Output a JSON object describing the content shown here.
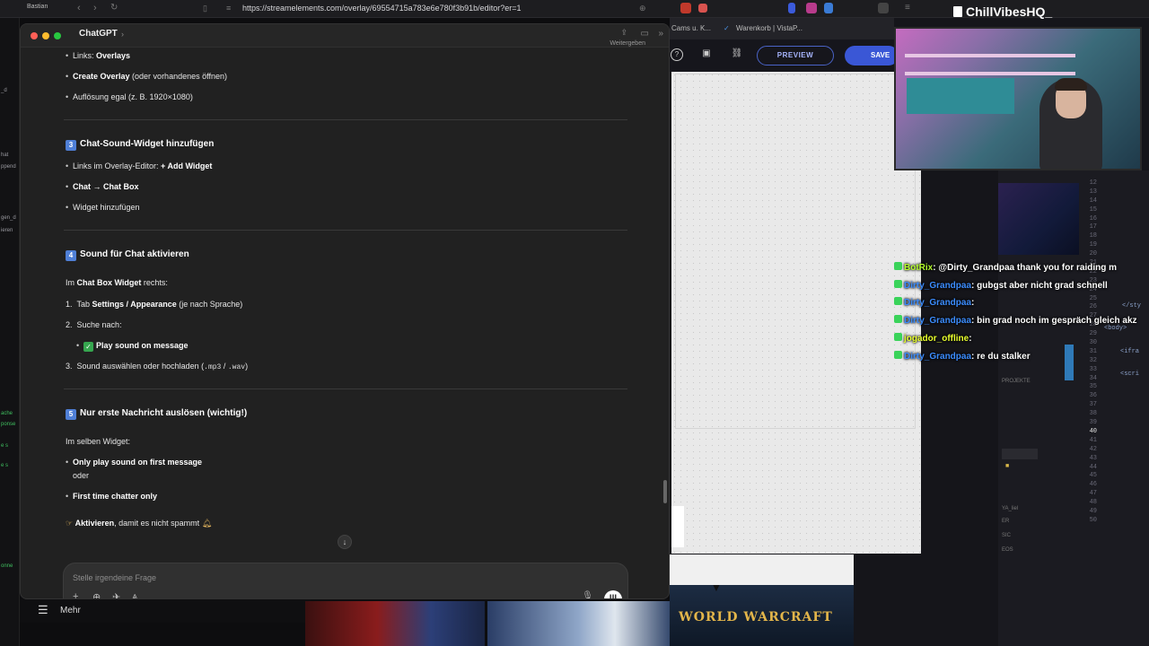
{
  "browser": {
    "tab_label": "Bastian",
    "url": "https://streamelements.com/overlay/69554715a783e6e780f3b91b/editor?er=1"
  },
  "left_strip": {
    "fragments": [
      "errysp",
      "_d",
      "hat",
      "ppend",
      "gen_d",
      "ieren",
      "ache",
      "ponse",
      "e s",
      "e s",
      "onne"
    ]
  },
  "chatgpt": {
    "window_title": "ChatGPT",
    "share_label": "Weitergeben",
    "section_links": {
      "line1_prefix": "Links: ",
      "line1_bold": "Overlays",
      "line2_bold": "Create Overlay",
      "line2_rest": " (oder vorhandenes öffnen)",
      "line3": "Auflösung egal (z. B. 1920×1080)"
    },
    "section3": {
      "badge": "3",
      "title": "Chat-Sound-Widget hinzufügen",
      "b1_prefix": "Links im Overlay-Editor: ",
      "b1_bold": "+ Add Widget",
      "b2_bold": "Chat → Chat Box",
      "b3": "Widget hinzufügen"
    },
    "section4": {
      "badge": "4",
      "title": "Sound für Chat aktivieren",
      "intro_prefix": "Im ",
      "intro_bold": "Chat Box Widget",
      "intro_rest": " rechts:",
      "step1_num": "1.",
      "step1_prefix": "Tab ",
      "step1_bold": "Settings / Appearance",
      "step1_rest": " (je nach Sprache)",
      "step2_num": "2.",
      "step2": "Suche nach:",
      "step2_sub_bold": "Play sound on message",
      "step3_num": "3.",
      "step3_prefix": "Sound auswählen oder hochladen (",
      "step3_code1": ".mp3",
      "step3_sep": " / ",
      "step3_code2": ".wav",
      "step3_rest": ")"
    },
    "section5": {
      "badge": "5",
      "title": "Nur erste Nachricht auslösen (wichtig!)",
      "intro": "Im selben Widget:",
      "b1_bold": "Only play sound on first message",
      "b1_sub": "oder",
      "b2_bold": "First time chatter only",
      "tip_bold": "Aktivieren",
      "tip_rest": ", damit es nicht spammt"
    },
    "composer_placeholder": "Stelle irgendeine Frage",
    "bottom_more": "Mehr"
  },
  "streamelements": {
    "tabs": [
      "Cams u. K...",
      "Warenkorb | VistaP..."
    ],
    "preview_label": "PREVIEW",
    "save_label": "SAVE"
  },
  "stream": {
    "channel": "ChillVibesHQ_",
    "game_logo": "WORLD WARCRAFT"
  },
  "chat_messages": [
    {
      "user": "BotRix",
      "text": ": @Dirty_Grandpaa thank you for raiding m",
      "color": "#b5ff2e"
    },
    {
      "user": "Dirty_Grandpaa",
      "text": ": gubgst aber nicht grad schnell",
      "color": "#3c8dff"
    },
    {
      "user": "Dirty_Grandpaa",
      "text": ":",
      "color": "#3c8dff"
    },
    {
      "user": "Dirty_Grandpaa",
      "text": ": bin grad noch im gespräch gleich akz",
      "color": "#3c8dff"
    },
    {
      "user": "jogador_offline",
      "text": ":",
      "color": "#e9ff2e"
    },
    {
      "user": "Dirty_Grandpaa",
      "text": ": re du stalker",
      "color": "#3c8dff"
    }
  ],
  "code_editor": {
    "line_numbers": [
      "12",
      "13",
      "14",
      "15",
      "16",
      "17",
      "18",
      "19",
      "20",
      "21",
      "22",
      "23",
      "24",
      "25",
      "26",
      "27",
      "28",
      "29",
      "30",
      "31",
      "32",
      "33",
      "34",
      "35",
      "36",
      "37",
      "38",
      "39",
      "40",
      "41",
      "42",
      "43",
      "44",
      "45",
      "46",
      "47",
      "48",
      "49",
      "50"
    ],
    "current_line": "40",
    "snippets": [
      "</sty",
      "<body>",
      "<ifra",
      "<scri"
    ],
    "panel_labels": [
      "PROJEKTE",
      "YA_liel",
      "ER",
      "SIC",
      "EOS"
    ]
  }
}
